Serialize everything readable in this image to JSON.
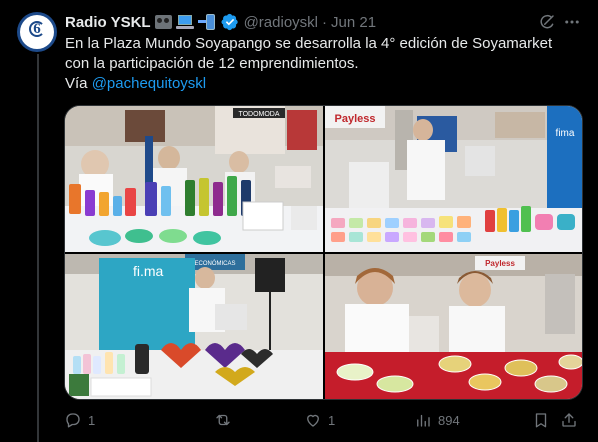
{
  "tweet": {
    "author": {
      "name": "Radio YSKL",
      "handle": "@radioyskl",
      "date": "Jun 21",
      "separator": "·",
      "avatar_text": "6",
      "emoji_icons": [
        "radio-emoji",
        "laptop-emoji",
        "mobile-phone-emoji"
      ],
      "verified": true
    },
    "text": {
      "line1": "En la Plaza Mundo Soyapango se desarrolla la 4° edición de Soyamarket",
      "line2": "con la participación de 12 emprendimientos.",
      "via_prefix": "Vía ",
      "mention": "@pachequitoyskl"
    },
    "media": {
      "photo1": {
        "sign_text": "TODOMODA"
      },
      "photo2": {
        "sign_text": "Payless",
        "side_text": "fima"
      },
      "photo3": {
        "banner_text": "fi.ma",
        "sign_text": "ECONÓMICAS"
      },
      "photo4": {
        "sign_text": "Payless"
      }
    },
    "actions": {
      "reply_count": "1",
      "retweet_count": "",
      "like_count": "1",
      "views_count": "894"
    }
  },
  "colors": {
    "background": "#000000",
    "text": "#e7e9ea",
    "muted": "#71767b",
    "accent": "#1d9bf0",
    "border": "#2f3336"
  }
}
